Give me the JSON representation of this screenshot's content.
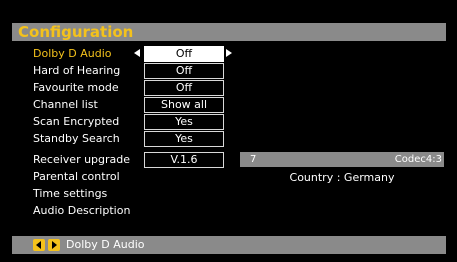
{
  "header": {
    "title": "Configuration"
  },
  "menu": {
    "items": [
      {
        "label": "Dolby D Audio",
        "value": "Off",
        "active": true
      },
      {
        "label": "Hard of Hearing",
        "value": "Off"
      },
      {
        "label": "Favourite mode",
        "value": "Off"
      },
      {
        "label": "Channel list",
        "value": "Show all"
      },
      {
        "label": "Scan Encrypted",
        "value": "Yes"
      },
      {
        "label": "Standby Search",
        "value": "Yes"
      },
      {
        "label": "Receiver upgrade",
        "value": "V.1.6"
      },
      {
        "label": "Parental control"
      },
      {
        "label": "Time settings"
      },
      {
        "label": "Audio Description"
      }
    ]
  },
  "preview": {
    "channel_number": "7",
    "codec": "Codec4:3",
    "country": "Country : Germany"
  },
  "footer": {
    "hint": "Dolby D Audio"
  },
  "colors": {
    "accent": "#f4c21c",
    "bar": "#8a8a8a",
    "background": "#000000"
  }
}
